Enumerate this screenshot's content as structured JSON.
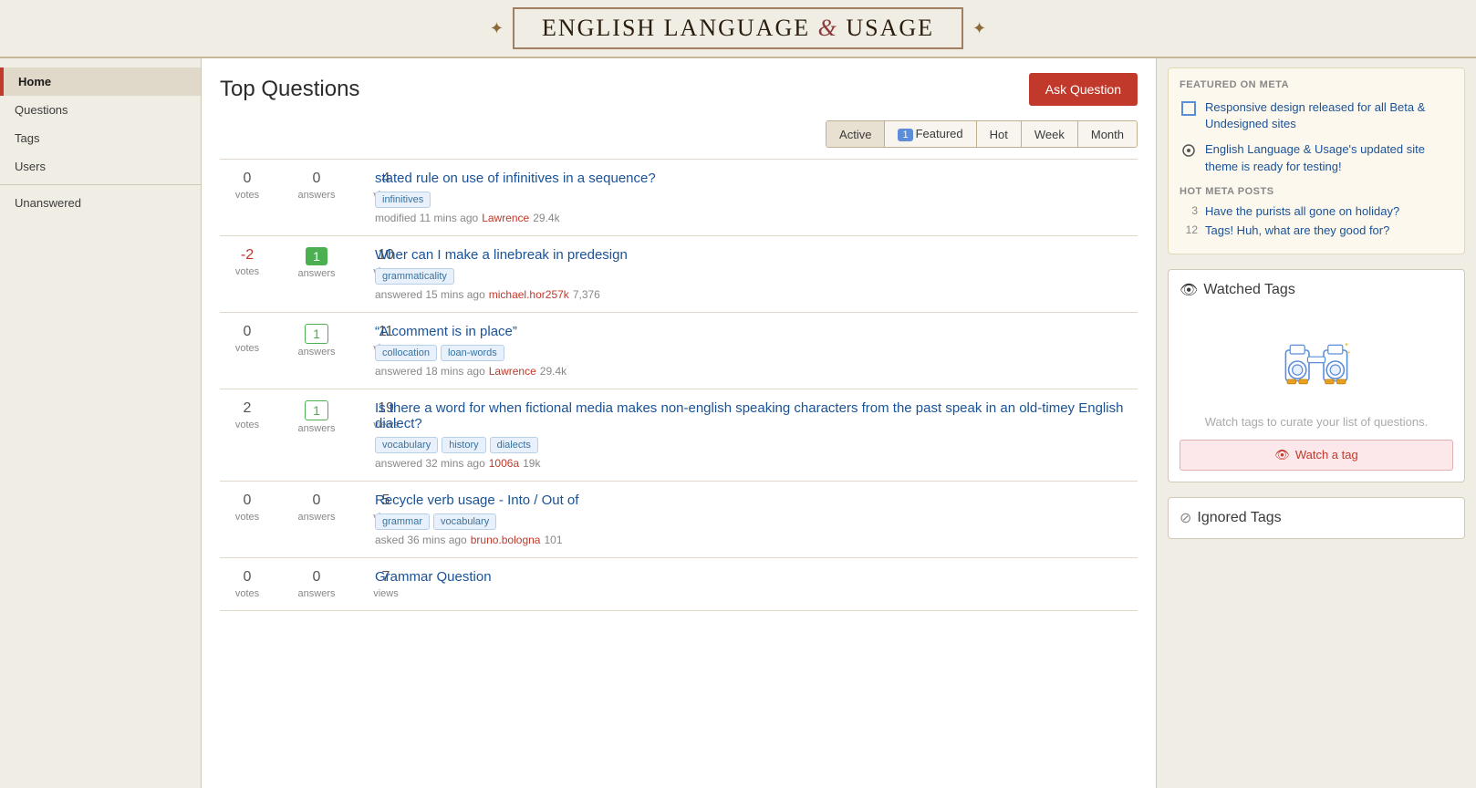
{
  "site": {
    "logo_text_before": "ENGLISH LANGUAGE",
    "logo_ampersand": "&",
    "logo_text_after": "USAGE"
  },
  "sidebar": {
    "items": [
      {
        "id": "home",
        "label": "Home",
        "active": true
      },
      {
        "id": "questions",
        "label": "Questions"
      },
      {
        "id": "tags",
        "label": "Tags"
      },
      {
        "id": "users",
        "label": "Users"
      },
      {
        "id": "unanswered",
        "label": "Unanswered"
      }
    ]
  },
  "content": {
    "page_title": "Top Questions",
    "ask_button": "Ask Question",
    "filter_tabs": [
      {
        "id": "active",
        "label": "Active",
        "active": true,
        "badge": null
      },
      {
        "id": "featured",
        "label": "Featured",
        "active": false,
        "badge": "1"
      },
      {
        "id": "hot",
        "label": "Hot",
        "active": false,
        "badge": null
      },
      {
        "id": "week",
        "label": "Week",
        "active": false,
        "badge": null
      },
      {
        "id": "month",
        "label": "Month",
        "active": false,
        "badge": null
      }
    ],
    "questions": [
      {
        "id": "q1",
        "votes": "0",
        "answers": "0",
        "views": "4",
        "answer_style": "normal",
        "title": "stated rule on use of infinitives in a sequence?",
        "tags": [
          "infinitives"
        ],
        "meta": "modified 11 mins ago",
        "user": "Lawrence",
        "user_rep": "29.4k",
        "action": "modified"
      },
      {
        "id": "q2",
        "votes": "-2",
        "answers": "1",
        "views": "10",
        "answer_style": "green",
        "title": "Wher can I make a linebreak in predesign",
        "tags": [
          "grammaticality"
        ],
        "meta": "answered 15 mins ago",
        "user": "michael.hor257k",
        "user_rep": "7,376",
        "action": "answered"
      },
      {
        "id": "q3",
        "votes": "0",
        "answers": "1",
        "views": "11",
        "answer_style": "outline",
        "title": "“A comment is in place”",
        "tags": [
          "collocation",
          "loan-words"
        ],
        "meta": "answered 18 mins ago",
        "user": "Lawrence",
        "user_rep": "29.4k",
        "action": "answered"
      },
      {
        "id": "q4",
        "votes": "2",
        "answers": "1",
        "views": "19",
        "answer_style": "outline",
        "title": "Is there a word for when fictional media makes non-english speaking characters from the past speak in an old-timey English dialect?",
        "tags": [
          "vocabulary",
          "history",
          "dialects"
        ],
        "meta": "answered 32 mins ago",
        "user": "1006a",
        "user_rep": "19k",
        "action": "answered"
      },
      {
        "id": "q5",
        "votes": "0",
        "answers": "0",
        "views": "5",
        "answer_style": "normal",
        "title": "Recycle verb usage - Into / Out of",
        "tags": [
          "grammar",
          "vocabulary"
        ],
        "meta": "asked 36 mins ago",
        "user": "bruno.bologna",
        "user_rep": "101",
        "action": "asked"
      },
      {
        "id": "q6",
        "votes": "0",
        "answers": "0",
        "views": "7",
        "answer_style": "normal",
        "title": "Grammar Question",
        "tags": [],
        "meta": "",
        "user": "",
        "user_rep": "",
        "action": ""
      }
    ]
  },
  "right_sidebar": {
    "featured_meta": {
      "title": "FEATURED ON META",
      "items": [
        {
          "id": "meta1",
          "icon": "square-icon",
          "text": "Responsive design released for all Beta & Undesigned sites"
        },
        {
          "id": "meta2",
          "icon": "ornament-icon",
          "text": "English Language & Usage's updated site theme is ready for testing!"
        }
      ],
      "hot_meta_title": "HOT META POSTS",
      "hot_meta_items": [
        {
          "num": "3",
          "text": "Have the purists all gone on holiday?"
        },
        {
          "num": "12",
          "text": "Tags! Huh, what are they good for?"
        }
      ]
    },
    "watched_tags": {
      "title": "Watched Tags",
      "empty_text": "Watch tags to curate your list of questions.",
      "watch_button": "Watch a tag"
    },
    "ignored_tags": {
      "title": "Ignored Tags"
    }
  }
}
